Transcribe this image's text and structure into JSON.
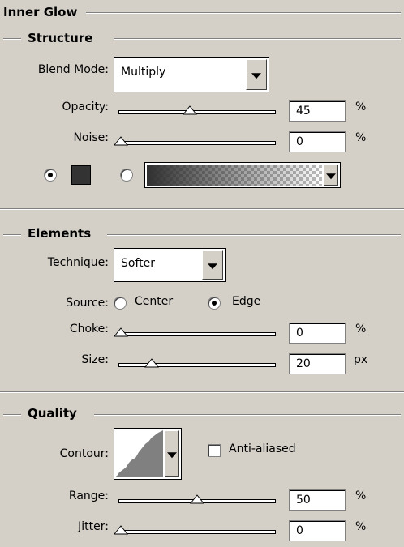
{
  "panel_title": "Inner Glow",
  "structure": {
    "title": "Structure",
    "blend_mode_label": "Blend Mode:",
    "blend_mode_value": "Multiply",
    "opacity_label": "Opacity:",
    "opacity_value": "45",
    "opacity_unit": "%",
    "opacity_level": 45,
    "noise_label": "Noise:",
    "noise_value": "0",
    "noise_unit": "%",
    "noise_level": 0,
    "color_swatch": "#333333",
    "gradient_from": "#303030"
  },
  "elements": {
    "title": "Elements",
    "technique_label": "Technique:",
    "technique_value": "Softer",
    "source_label": "Source:",
    "source_center_label": "Center",
    "source_edge_label": "Edge",
    "choke_label": "Choke:",
    "choke_value": "0",
    "choke_unit": "%",
    "choke_level": 0,
    "size_label": "Size:",
    "size_value": "20",
    "size_unit": "px",
    "size_level": 20
  },
  "quality": {
    "title": "Quality",
    "contour_label": "Contour:",
    "anti_aliased_label": "Anti-aliased",
    "range_label": "Range:",
    "range_value": "50",
    "range_unit": "%",
    "range_level": 50,
    "jitter_label": "Jitter:",
    "jitter_value": "0",
    "jitter_unit": "%",
    "jitter_level": 0
  }
}
